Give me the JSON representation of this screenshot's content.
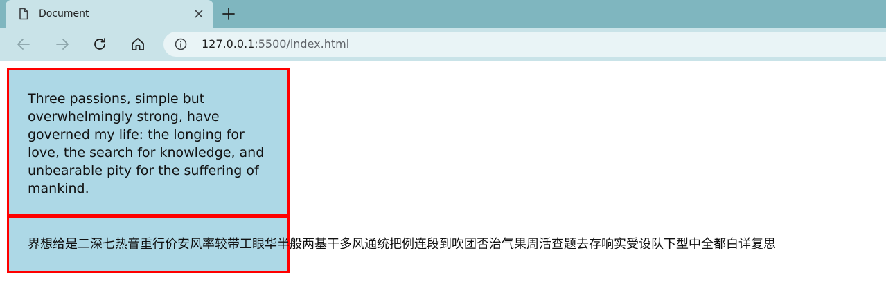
{
  "browser": {
    "tab": {
      "title": "Document",
      "icon": "document-icon",
      "close_icon": "close-icon"
    },
    "new_tab_icon": "plus-icon",
    "nav": {
      "back_icon": "back-arrow-icon",
      "forward_icon": "forward-arrow-icon",
      "reload_icon": "reload-icon",
      "home_icon": "home-icon"
    },
    "address": {
      "host": "127.0.0.1",
      "path": ":5500/index.html",
      "info_icon": "info-icon"
    }
  },
  "content": {
    "paragraph_en": "Three passions, simple but overwhelmingly strong, have governed my life: the longing for love, the search for knowledge, and unbearable pity for the suffering of mankind.",
    "paragraph_zh": "界想给是二深七热音重行价安风率较带工眼华半般两基干多风通统把例连段到吹团否治气果周活查题去存响实受设队下型中全都白详复思"
  },
  "colors": {
    "tabstrip": "#7fb6bf",
    "toolbar": "#c9e3e8",
    "box_background": "#add8e6",
    "box_border": "#ff0000"
  }
}
